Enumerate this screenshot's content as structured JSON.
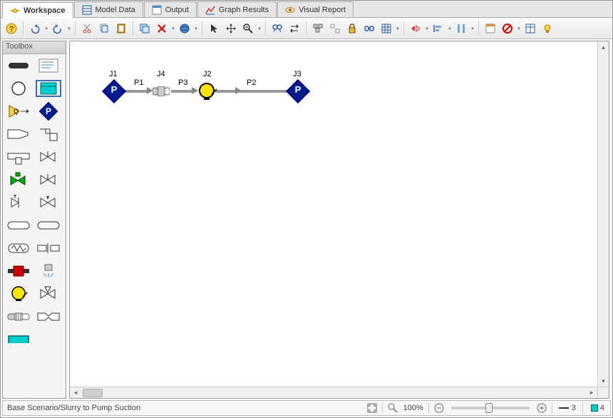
{
  "tabs": [
    {
      "label": "Workspace",
      "active": true
    },
    {
      "label": "Model Data",
      "active": false
    },
    {
      "label": "Output",
      "active": false
    },
    {
      "label": "Graph Results",
      "active": false
    },
    {
      "label": "Visual Report",
      "active": false
    }
  ],
  "toolbox": {
    "title": "Toolbox"
  },
  "junctions": {
    "J1": {
      "label": "J1",
      "symbol": "P"
    },
    "J4": {
      "label": "J4"
    },
    "J2": {
      "label": "J2"
    },
    "J3": {
      "label": "J3",
      "symbol": "P"
    }
  },
  "pipes": {
    "P1": {
      "label": "P1"
    },
    "P3": {
      "label": "P3"
    },
    "P2": {
      "label": "P2"
    }
  },
  "status": {
    "path": "Base Scenario/Slurry to Pump Suction",
    "zoom_pct": "100%",
    "count_left": "3",
    "count_right": "4"
  },
  "colors": {
    "diamond_fill": "#001f8b",
    "pump_fill": "#ffe600",
    "pipe": "#999999"
  }
}
